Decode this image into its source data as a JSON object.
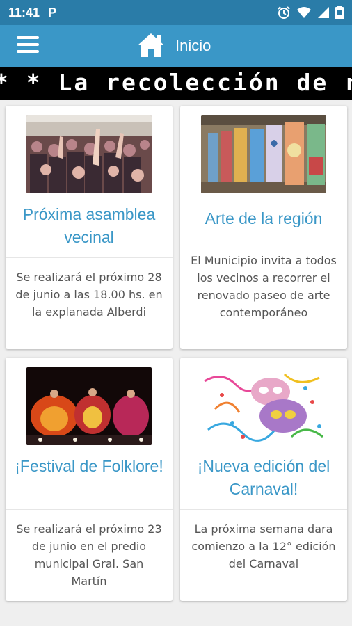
{
  "status_bar": {
    "time": "11:41",
    "notification": "P"
  },
  "app_bar": {
    "title": "Inicio"
  },
  "ticker": {
    "text": "* * La recolección de re"
  },
  "cards": [
    {
      "title": "Próxima asamblea vecinal",
      "description": "Se realizará el próximo 28 de junio a las 18.00 hs. en la explanada Alberdi"
    },
    {
      "title": "Arte de la región",
      "description": "El Municipio invita a todos los vecinos a recorrer el renovado paseo de arte contemporáneo"
    },
    {
      "title": "¡Festival de Folklore!",
      "description": "Se realizará el próximo 23 de junio en el predio municipal Gral. San Martín"
    },
    {
      "title": "¡Nueva edición del Carnaval!",
      "description": "La próxima semana dara comienzo a la 12° edición del Carnaval"
    }
  ],
  "colors": {
    "app_bar": "#3a97c7",
    "status_bar": "#2a7ca8",
    "title_text": "#3a97c7"
  },
  "icons": [
    "menu-icon",
    "home-icon",
    "alarm-icon",
    "wifi-icon",
    "signal-icon",
    "battery-icon"
  ]
}
